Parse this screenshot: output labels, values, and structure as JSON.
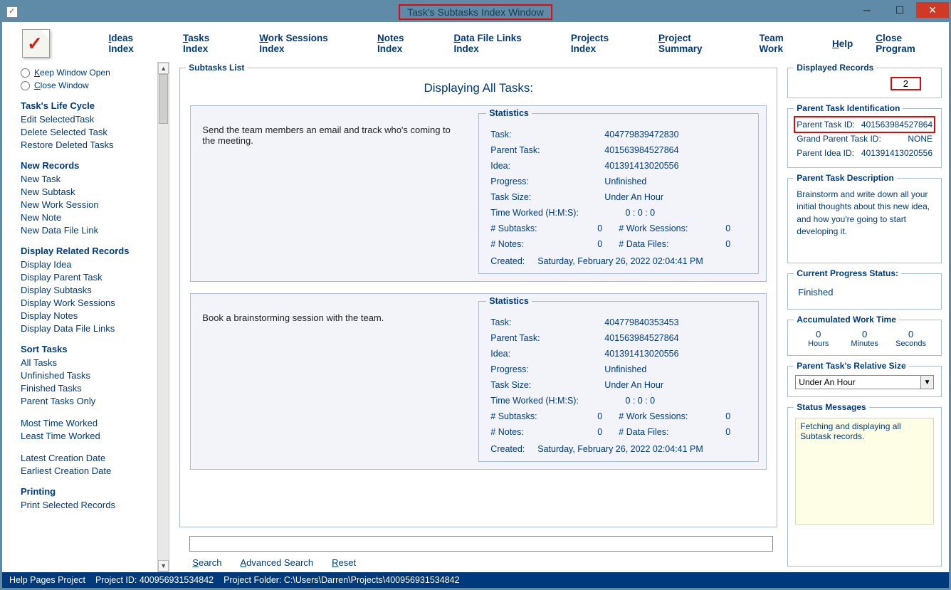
{
  "window": {
    "title": "Task's Subtasks Index Window"
  },
  "menu": {
    "ideas": "Ideas Index",
    "tasks": "Tasks Index",
    "work_sessions": "Work Sessions Index",
    "notes": "Notes Index",
    "data_links": "Data File Links Index",
    "projects": "Projects Index",
    "project_summary": "Project Summary",
    "team_work": "Team Work",
    "help": "Help",
    "close": "Close Program"
  },
  "sidebar": {
    "keep_open": "Keep Window Open",
    "close_window": "Close Window",
    "groups": {
      "lifecycle": {
        "title": "Task's Life Cycle",
        "items": [
          "Edit SelectedTask",
          "Delete Selected Task",
          "Restore Deleted Tasks"
        ]
      },
      "new_records": {
        "title": "New Records",
        "items": [
          "New Task",
          "New Subtask",
          "New Work Session",
          "New Note",
          "New Data File Link"
        ]
      },
      "display_related": {
        "title": "Display Related Records",
        "items": [
          "Display Idea",
          "Display Parent Task",
          "Display Subtasks",
          "Display Work Sessions",
          "Display Notes",
          "Display Data File Links"
        ]
      },
      "sort": {
        "title": "Sort Tasks",
        "items": [
          "All Tasks",
          "Unfinished Tasks",
          "Finished Tasks",
          "Parent Tasks Only"
        ]
      },
      "time": {
        "items": [
          "Most Time Worked",
          "Least Time Worked"
        ]
      },
      "date": {
        "items": [
          "Latest Creation Date",
          "Earliest Creation Date"
        ]
      },
      "printing": {
        "title": "Printing",
        "items": [
          "Print Selected Records"
        ]
      }
    }
  },
  "main": {
    "list_title_box": "Subtasks List",
    "display_title": "Displaying All Tasks:",
    "cards": [
      {
        "text": "Send the team members an email and track who's coming to the meeting.",
        "stats": {
          "title": "Statistics",
          "task": "404779839472830",
          "parent_task": "401563984527864",
          "idea": "401391413020556",
          "progress": "Unfinished",
          "task_size": "Under An Hour",
          "time_worked": "0  :  0  :  0",
          "subtasks": "0",
          "work_sessions": "0",
          "notes": "0",
          "data_files": "0",
          "created": "Saturday, February 26, 2022   02:04:41 PM"
        }
      },
      {
        "text": "Book a brainstorming session with the team.",
        "stats": {
          "title": "Statistics",
          "task": "404779840353453",
          "parent_task": "401563984527864",
          "idea": "401391413020556",
          "progress": "Unfinished",
          "task_size": "Under An Hour",
          "time_worked": "0  :  0  :  0",
          "subtasks": "0",
          "work_sessions": "0",
          "notes": "0",
          "data_files": "0",
          "created": "Saturday, February 26, 2022   02:04:41 PM"
        }
      }
    ],
    "stat_labels": {
      "task": "Task:",
      "parent": "Parent Task:",
      "idea": "Idea:",
      "progress": "Progress:",
      "size": "Task Size:",
      "timeworked": "Time Worked (H:M:S):",
      "subtasks": "# Subtasks:",
      "worksessions": "# Work Sessions:",
      "notes": "# Notes:",
      "datafiles": "# Data Files:",
      "created": "Created:"
    },
    "search": {
      "search": "Search",
      "advanced": "Advanced Search",
      "reset": "Reset"
    }
  },
  "right": {
    "displayed_records": {
      "title": "Displayed Records",
      "count": "2"
    },
    "parent_id": {
      "title": "Parent Task Identification",
      "parent_label": "Parent Task ID:",
      "parent_val": "401563984527864",
      "grand_label": "Grand Parent Task ID:",
      "grand_val": "NONE",
      "idea_label": "Parent Idea ID:",
      "idea_val": "401391413020556"
    },
    "parent_desc": {
      "title": "Parent Task Description",
      "text": "Brainstorm and write down all your initial thoughts about this new idea, and how you're going to start developing it."
    },
    "progress": {
      "title": "Current Progress Status:",
      "value": "Finished"
    },
    "acc_time": {
      "title": "Accumulated Work Time",
      "h": "0",
      "m": "0",
      "s": "0",
      "hl": "Hours",
      "ml": "Minutes",
      "sl": "Seconds"
    },
    "rel_size": {
      "title": "Parent Task's Relative Size",
      "value": "Under An Hour"
    },
    "status": {
      "title": "Status Messages",
      "text": "Fetching and displaying all Subtask records."
    }
  },
  "statusbar": {
    "help": "Help Pages Project",
    "project_id": "Project ID:  400956931534842",
    "folder": "Project Folder:  C:\\Users\\Darren\\Projects\\400956931534842"
  }
}
